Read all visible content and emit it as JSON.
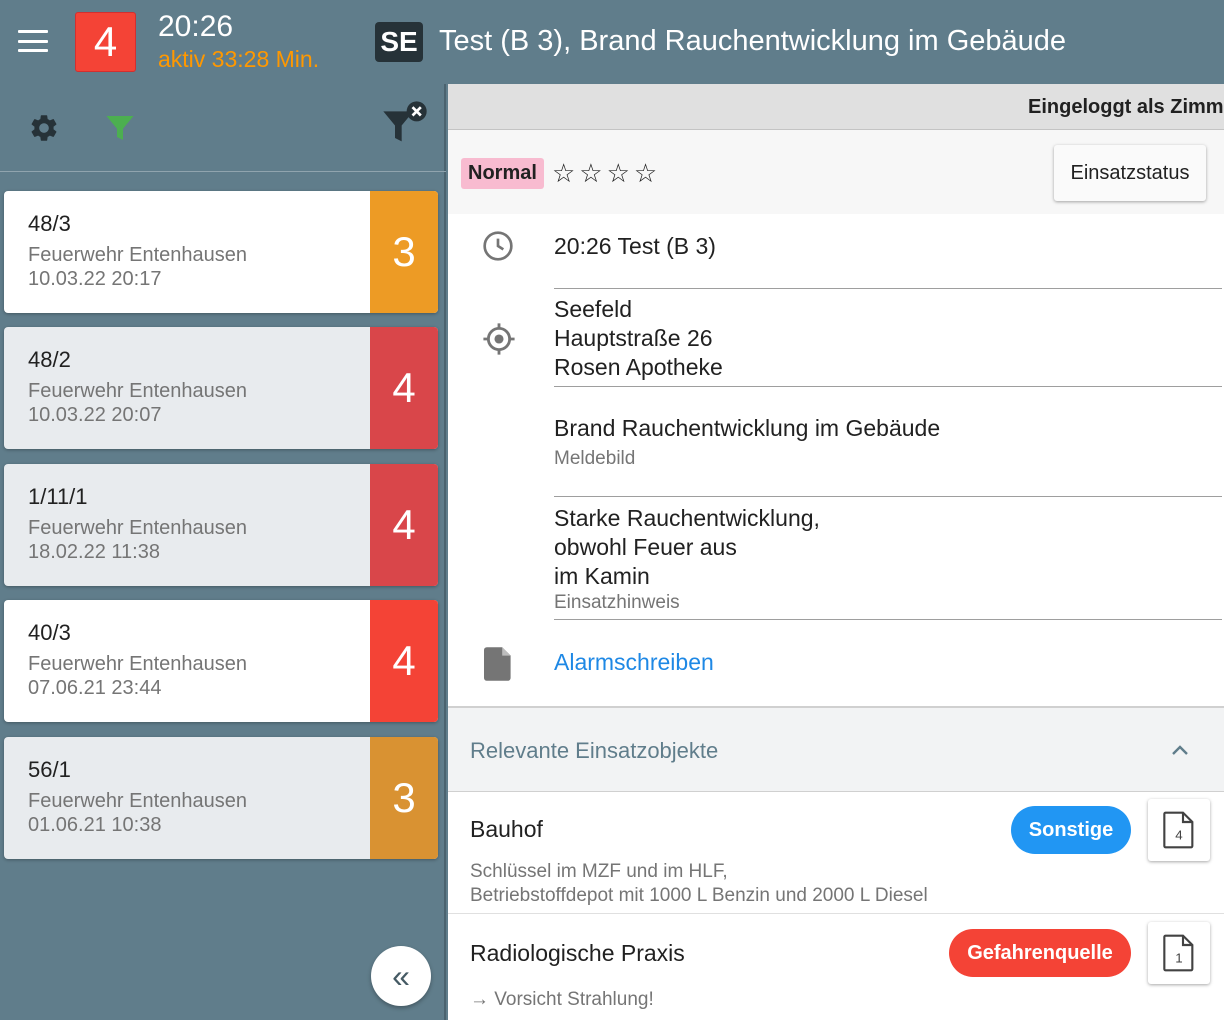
{
  "header": {
    "status_number": "4",
    "status_color": "#f44336",
    "time": "20:26",
    "active": "aktiv 33:28 Min.",
    "se_label": "SE",
    "title": "Test (B 3), Brand Rauchentwicklung im Gebäude"
  },
  "sidebar": {
    "icons": [
      "gear-icon",
      "filter-icon",
      "filter-clear-icon"
    ],
    "cards": [
      {
        "number": "48/3",
        "org": "Feuerwehr Entenhausen",
        "date": "10.03.22 20:17",
        "status": "3",
        "status_color": "#ed9b25",
        "bg": "#ffffff"
      },
      {
        "number": "48/2",
        "org": "Feuerwehr Entenhausen",
        "date": "10.03.22 20:07",
        "status": "4",
        "status_color": "#d9464a",
        "bg": "#e8ebee"
      },
      {
        "number": "1/11/1",
        "org": "Feuerwehr Entenhausen",
        "date": "18.02.22 11:38",
        "status": "4",
        "status_color": "#d9464a",
        "bg": "#e8ebee"
      },
      {
        "number": "40/3",
        "org": "Feuerwehr Entenhausen",
        "date": "07.06.21 23:44",
        "status": "4",
        "status_color": "#f44336",
        "bg": "#ffffff"
      },
      {
        "number": "56/1",
        "org": "Feuerwehr Entenhausen",
        "date": "01.06.21 10:38",
        "status": "3",
        "status_color": "#d99232",
        "bg": "#e8ebee"
      }
    ],
    "collapse_label": "«"
  },
  "main": {
    "login_text": "Eingeloggt als Zimme",
    "priority": "Normal",
    "stars": "☆☆☆☆",
    "einsatzstatus_label": "Einsatzstatus",
    "time_row": "20:26 Test (B 3)",
    "location": [
      "Seefeld",
      "Hauptstraße 26",
      "Rosen Apotheke"
    ],
    "meldebild": "Brand Rauchentwicklung im Gebäude",
    "meldebild_label": "Meldebild",
    "hinweis": [
      "Starke Rauchentwicklung,",
      "obwohl Feuer aus",
      "im Kamin"
    ],
    "hinweis_label": "Einsatzhinweis",
    "alarm_link": "Alarmschreiben",
    "section_title": "Relevante Einsatzobjekte",
    "objects": [
      {
        "name": "Bauhof",
        "tag": "Sonstige",
        "tag_color": "#2196f3",
        "doc_count": "4",
        "desc": [
          "Schlüssel im MZF und im HLF,",
          "Betriebstoffdepot mit 1000 L Benzin und 2000 L Diesel"
        ]
      },
      {
        "name": "Radiologische Praxis",
        "tag": "Gefahrenquelle",
        "tag_color": "#f44336",
        "doc_count": "1",
        "desc": [
          "→ Vorsicht Strahlung!"
        ]
      }
    ]
  }
}
